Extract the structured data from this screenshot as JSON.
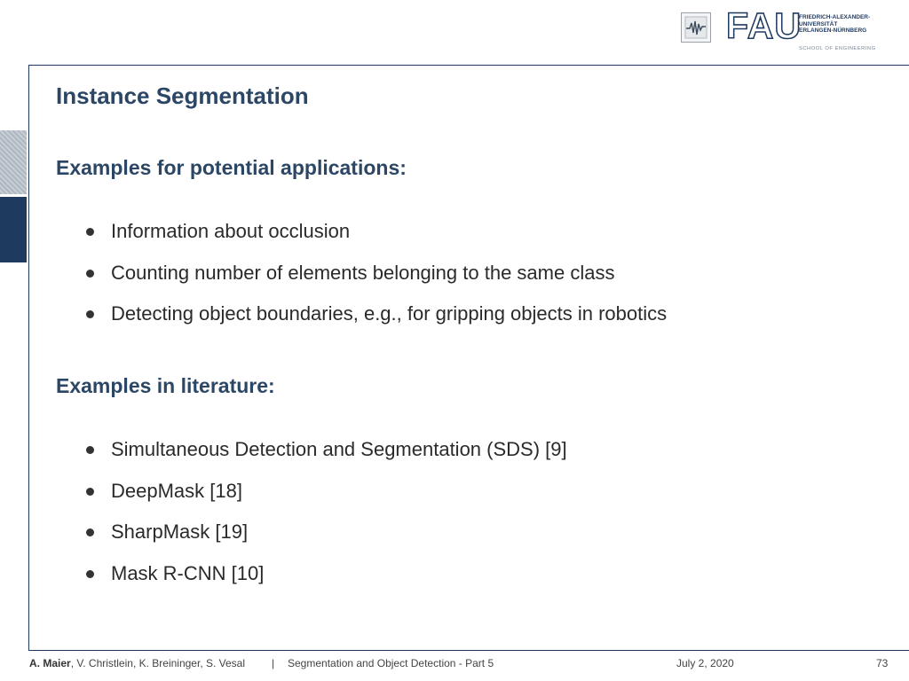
{
  "header": {
    "lme_logo_icon": "waveform-logo-icon",
    "fau_logo": {
      "wordmark": "FAU",
      "university_lines": [
        "FRIEDRICH-ALEXANDER-",
        "UNIVERSITÄT",
        "ERLANGEN-NÜRNBERG"
      ],
      "school": "SCHOOL OF ENGINEERING"
    }
  },
  "slide": {
    "title": "Instance Segmentation",
    "sections": [
      {
        "heading": "Examples for potential applications:",
        "items": [
          "Information about occlusion",
          "Counting number of elements belonging to the same class",
          "Detecting object boundaries, e.g., for gripping objects in robotics"
        ]
      },
      {
        "heading": "Examples in literature:",
        "items": [
          "Simultaneous Detection and Segmentation (SDS) [9]",
          "DeepMask [18]",
          "SharpMask [19]",
          "Mask R-CNN [10]"
        ]
      }
    ]
  },
  "footer": {
    "lead_author": "A. Maier",
    "coauthors": ", V. Christlein, K. Breininger, S. Vesal",
    "separator": "|",
    "lecture": "Segmentation and Object Detection - Part 5",
    "date": "July 2, 2020",
    "page": "73"
  },
  "colors": {
    "accent": "#2c4766",
    "frame": "#1f3a5f",
    "text": "#2a2a2a"
  }
}
